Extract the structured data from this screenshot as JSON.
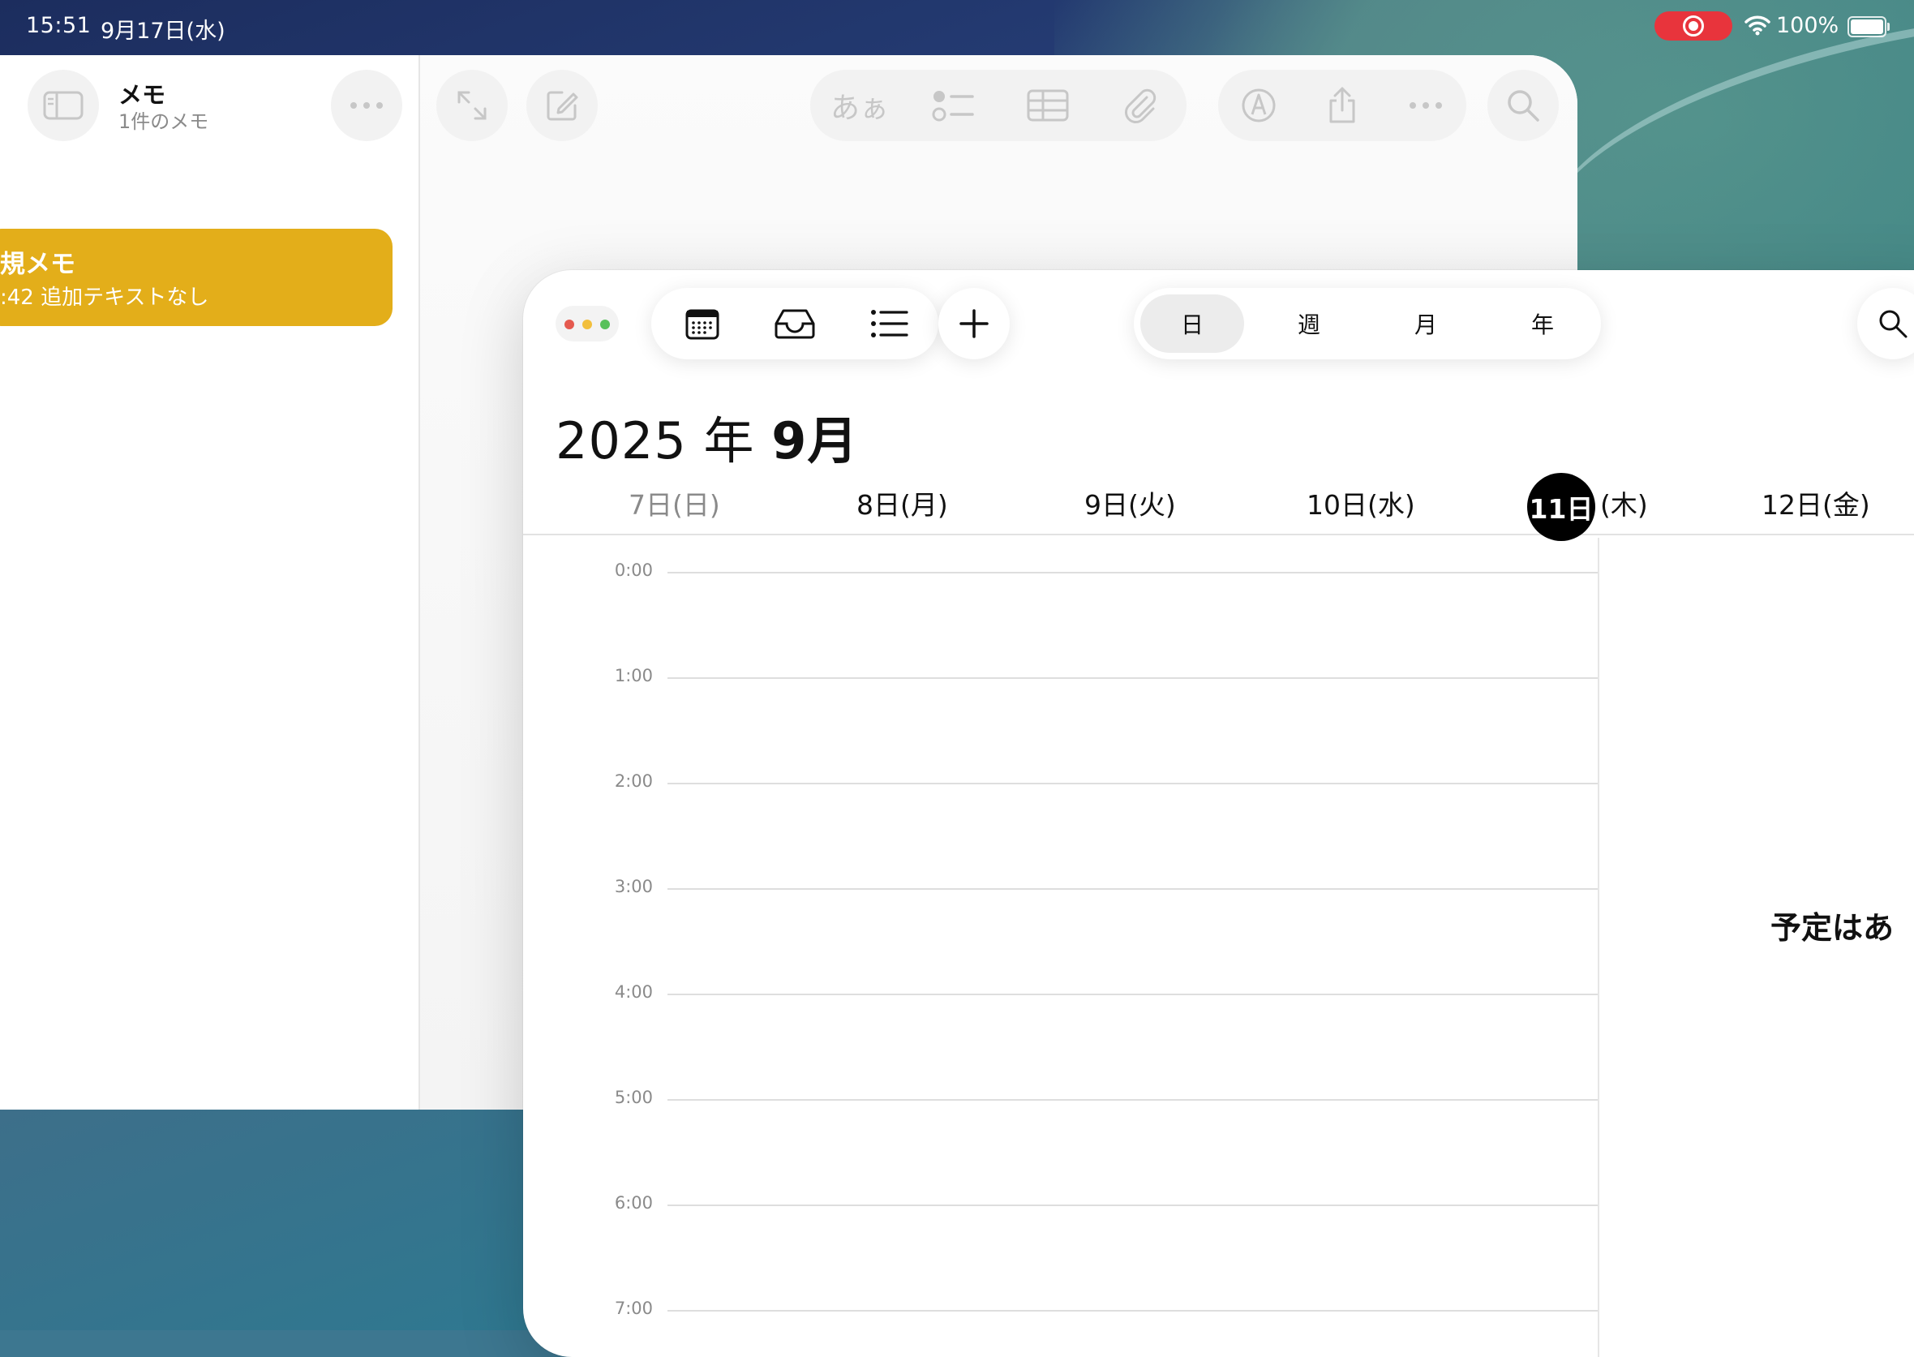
{
  "status_bar": {
    "time": "15:51",
    "date": "9月17日(水)",
    "battery": "100%"
  },
  "notes": {
    "title": "メモ",
    "subtitle": "1件のメモ",
    "note_card": {
      "title": "規メモ",
      "snippet": ":42 追加テキストなし",
      "color": "#e3ae1a"
    },
    "toolbar": {
      "text_format_label": "あぁ"
    },
    "icons": [
      "sidebar-toggle-icon",
      "ellipsis-icon",
      "expand-icon",
      "compose-icon",
      "checklist-icon",
      "table-icon",
      "paperclip-icon",
      "markup-icon",
      "share-icon",
      "more-icon",
      "search-icon"
    ]
  },
  "calendar": {
    "view_segments": [
      "日",
      "週",
      "月",
      "年"
    ],
    "active_segment": "日",
    "month_title_year": "2025 年",
    "month_title_month": "9月",
    "days": [
      {
        "label": "7日(日)",
        "muted": true
      },
      {
        "label": "8日(月)",
        "muted": false
      },
      {
        "label": "9日(火)",
        "muted": false
      },
      {
        "label": "10日(水)",
        "muted": false
      },
      {
        "label": "(木)",
        "muted": false,
        "today": "11日"
      },
      {
        "label": "12日(金)",
        "muted": false
      }
    ],
    "hours": [
      "0:00",
      "1:00",
      "2:00",
      "3:00",
      "4:00",
      "5:00",
      "6:00",
      "7:00"
    ],
    "no_events_text": "予定はあ",
    "traffic_colors": [
      "#e55a4f",
      "#f2bf3c",
      "#58c15a"
    ]
  }
}
